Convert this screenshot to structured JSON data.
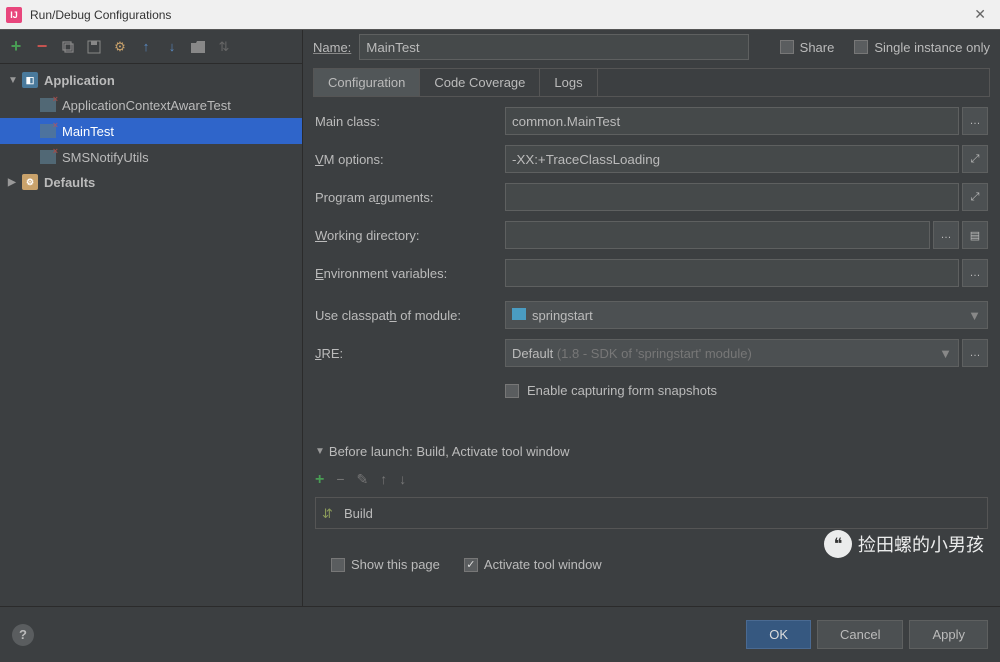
{
  "window": {
    "title": "Run/Debug Configurations"
  },
  "sidebar": {
    "nodes": [
      {
        "label": "Application",
        "expanded": true,
        "children": [
          {
            "label": "ApplicationContextAwareTest",
            "selected": false
          },
          {
            "label": "MainTest",
            "selected": true
          },
          {
            "label": "SMSNotifyUtils",
            "selected": false
          }
        ]
      },
      {
        "label": "Defaults",
        "expanded": false
      }
    ]
  },
  "header": {
    "name_label": "Name:",
    "name_value": "MainTest",
    "share_label": "Share",
    "single_instance_label": "Single instance only"
  },
  "tabs": [
    {
      "label": "Configuration",
      "active": true
    },
    {
      "label": "Code Coverage",
      "active": false
    },
    {
      "label": "Logs",
      "active": false
    }
  ],
  "form": {
    "main_class": {
      "label": "Main class:",
      "value": "common.MainTest"
    },
    "vm_options": {
      "label": "VM options:",
      "value": "-XX:+TraceClassLoading"
    },
    "program_args": {
      "label": "Program arguments:",
      "value": ""
    },
    "working_dir": {
      "label": "Working directory:",
      "value": ""
    },
    "env_vars": {
      "label": "Environment variables:",
      "value": ""
    },
    "classpath": {
      "label": "Use classpath of module:",
      "value": "springstart"
    },
    "jre": {
      "label": "JRE:",
      "value": "Default",
      "hint": "(1.8 - SDK of 'springstart' module)"
    },
    "snapshots_label": "Enable capturing form snapshots"
  },
  "before_launch": {
    "title": "Before launch: Build, Activate tool window",
    "items": [
      {
        "label": "Build"
      }
    ],
    "show_page_label": "Show this page",
    "activate_label": "Activate tool window"
  },
  "footer": {
    "ok": "OK",
    "cancel": "Cancel",
    "apply": "Apply"
  },
  "watermark": "捡田螺的小男孩"
}
